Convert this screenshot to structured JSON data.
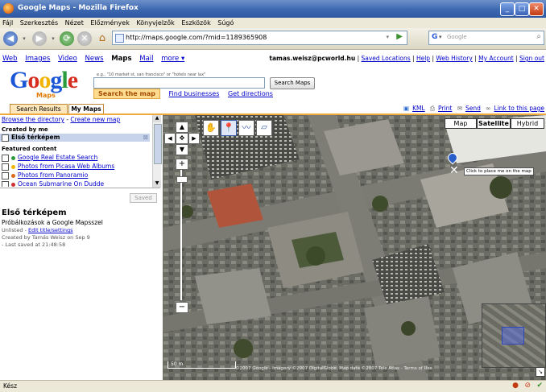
{
  "window": {
    "title": "Google Maps - Mozilla Firefox"
  },
  "menu": [
    "Fájl",
    "Szerkesztés",
    "Nézet",
    "Előzmények",
    "Könyvjelzők",
    "Eszközök",
    "Súgó"
  ],
  "url": "http://maps.google.com/?mid=1189365908",
  "browser_search": {
    "engine": "G",
    "placeholder": "Google"
  },
  "gbar": {
    "links": [
      "Web",
      "Images",
      "Video",
      "News",
      "Maps",
      "Mail",
      "more ▾"
    ],
    "account": "tamas.weisz@pcworld.hu",
    "account_links": [
      "Saved Locations",
      "Help",
      "Web History",
      "My Account",
      "Sign out"
    ]
  },
  "logo": {
    "text": "Google",
    "sub": "Maps"
  },
  "search": {
    "hint": "e.g., \"10 market st, san francisco\" or \"hotels near lax\"",
    "button": "Search Maps",
    "tabs": [
      "Search the map",
      "Find businesses",
      "Get directions"
    ]
  },
  "panel": {
    "tabs": [
      "Search Results",
      "My Maps"
    ],
    "tools": [
      "KML",
      "Print",
      "Send",
      "Link to this page"
    ],
    "browse": "Browse the directory",
    "create": "Create new map",
    "created_by": "Created by me",
    "my_map": "Első térképem",
    "featured": "Featured content",
    "featured_items": [
      {
        "label": "Google Real Estate Search",
        "color": "#2b9a3c"
      },
      {
        "label": "Photos from Picasa Web Albums",
        "color": "#f4b400"
      },
      {
        "label": "Photos from Panoramio",
        "color": "#e06a1a"
      },
      {
        "label": "Ocean Submarine On Dudde",
        "color": "#d03030"
      }
    ],
    "saved_button": "Saved",
    "map_title": "Első térképem",
    "map_desc": "Próbálkozások a Google Mapsszel",
    "unlisted": "Unlisted",
    "edit": "Edit title/settings",
    "created_line": "Created by Tamás Weisz on Sep 9",
    "last_saved": "Last saved at 21:48:58"
  },
  "map": {
    "types": [
      "Map",
      "Satellite",
      "Hybrid"
    ],
    "active_type": "Satellite",
    "tooltip": "Click to place me on the map",
    "scale": "50 m",
    "copyright": "©2007 Google - Imagery ©2007 DigitalGlobe, Map data ©2007 Tele Atlas - Terms of Use"
  },
  "status": "Kész"
}
